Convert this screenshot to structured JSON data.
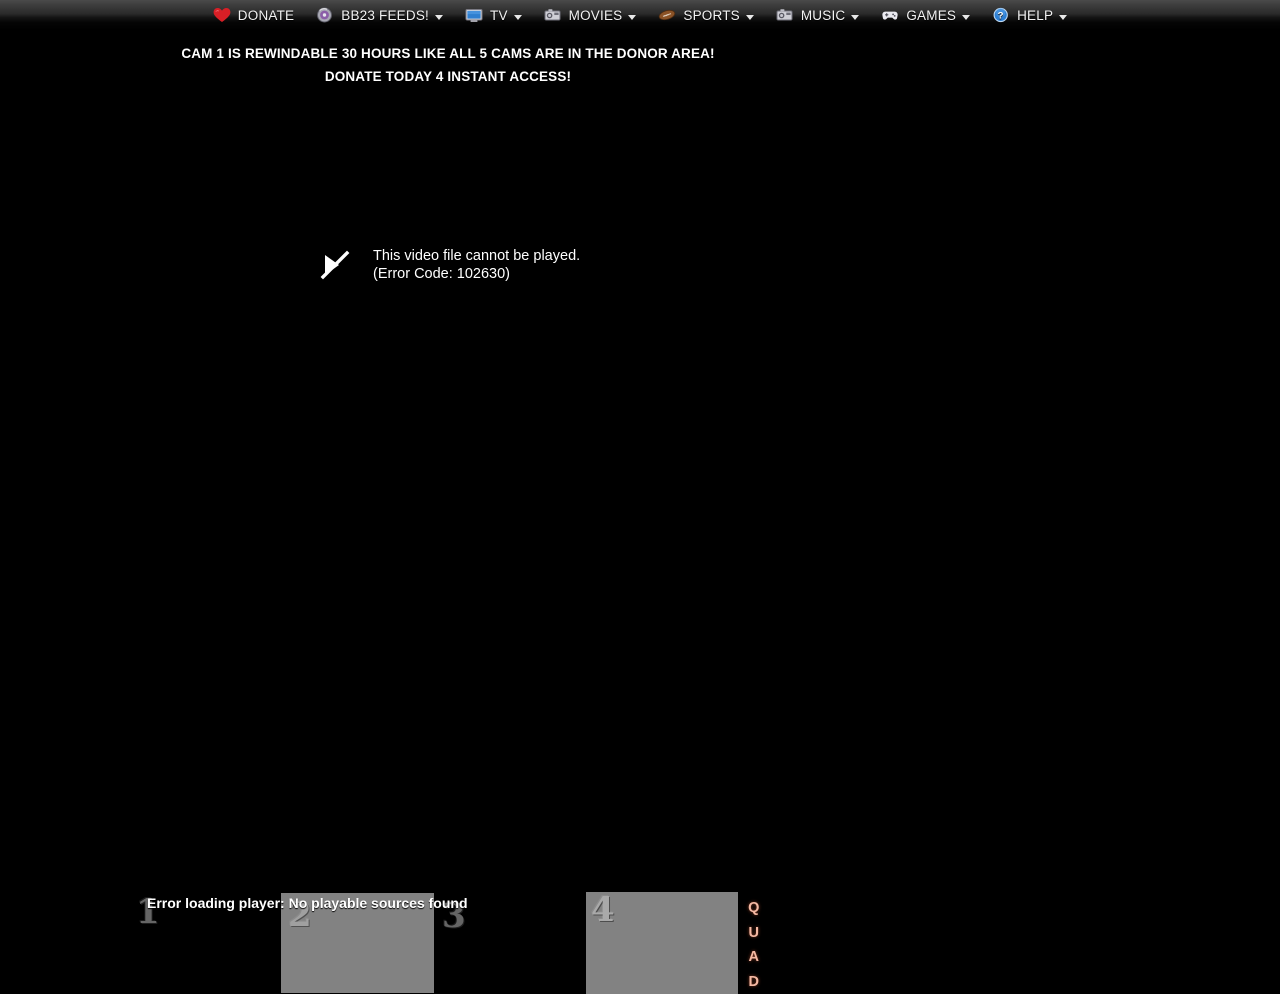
{
  "navbar": {
    "items": [
      {
        "label": "DONATE",
        "icon": "heart-icon",
        "has_caret": false
      },
      {
        "label": "BB23 FEEDS!",
        "icon": "disc-icon",
        "has_caret": true
      },
      {
        "label": "TV",
        "icon": "monitor-icon",
        "has_caret": true
      },
      {
        "label": "MOVIES",
        "icon": "camera-icon",
        "has_caret": true
      },
      {
        "label": "SPORTS",
        "icon": "football-icon",
        "has_caret": true
      },
      {
        "label": "MUSIC",
        "icon": "camera-icon",
        "has_caret": true
      },
      {
        "label": "GAMES",
        "icon": "gamepad-icon",
        "has_caret": true
      },
      {
        "label": "HELP",
        "icon": "question-icon",
        "has_caret": true
      }
    ]
  },
  "banner": {
    "line1": "CAM 1 IS REWINDABLE 30 HOURS LIKE ALL 5 CAMS ARE IN THE DONOR AREA!",
    "line2": "DONATE TODAY 4 INSTANT ACCESS!"
  },
  "player": {
    "error_icon": "play-slash-icon",
    "error_line1": "This video file cannot be played.",
    "error_line2": "(Error Code: 102630)"
  },
  "quad": {
    "error_text": "Error loading player: No playable sources found",
    "digits": [
      "1",
      "2",
      "3",
      "4"
    ],
    "word": [
      "Q",
      "U",
      "A",
      "D"
    ],
    "word_color": "#f5b9a3",
    "panel_color": "#828282"
  },
  "colors": {
    "page_background": "#000000",
    "navbar_top": "#4a4a4a",
    "navbar_bottom": "#000000",
    "text": "#ffffff",
    "heart": "#e0262c",
    "tv_screen": "#2f7fd0",
    "football": "#8a5226",
    "help_blue": "#2d7fd4"
  }
}
